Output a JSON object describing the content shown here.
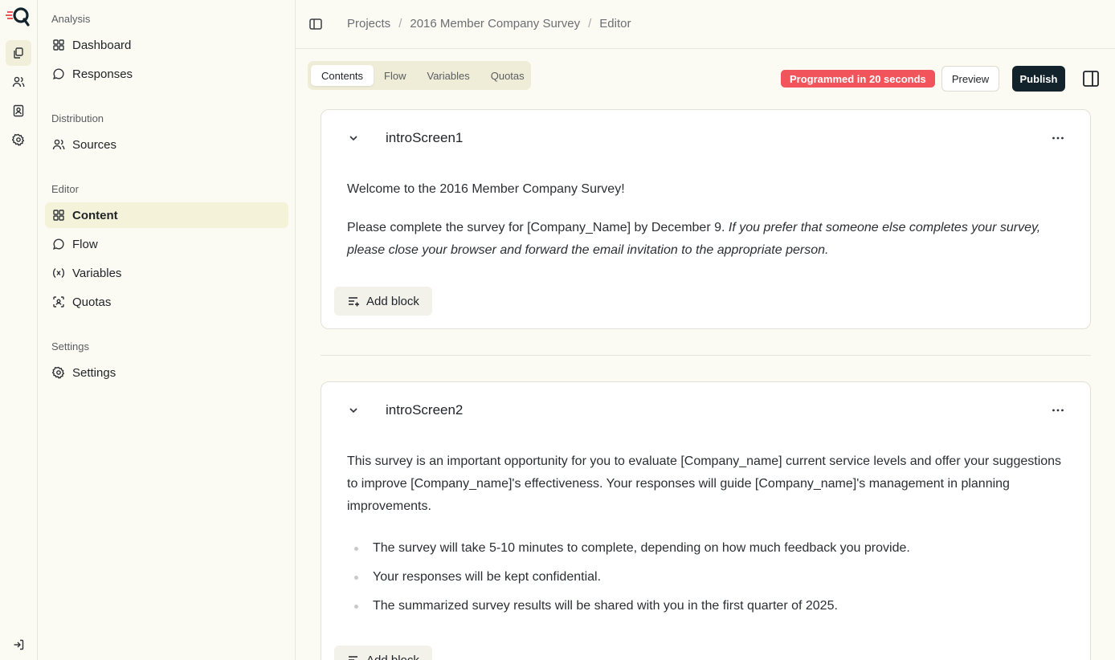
{
  "rail": {
    "icons": [
      "logo-icon",
      "projects-icon",
      "users-icon",
      "contacts-icon",
      "settings-icon",
      "logout-icon"
    ]
  },
  "sidebar": {
    "groups": [
      {
        "label": "Analysis",
        "items": [
          {
            "label": "Dashboard",
            "icon": "grid-icon"
          },
          {
            "label": "Responses",
            "icon": "chat-icon"
          }
        ]
      },
      {
        "label": "Distribution",
        "items": [
          {
            "label": "Sources",
            "icon": "users-icon"
          }
        ]
      },
      {
        "label": "Editor",
        "items": [
          {
            "label": "Content",
            "icon": "grid-icon",
            "active": true
          },
          {
            "label": "Flow",
            "icon": "chat-icon"
          },
          {
            "label": "Variables",
            "icon": "variable-icon"
          },
          {
            "label": "Quotas",
            "icon": "quota-icon"
          }
        ]
      },
      {
        "label": "Settings",
        "items": [
          {
            "label": "Settings",
            "icon": "gear-icon"
          }
        ]
      }
    ]
  },
  "breadcrumb": [
    "Projects",
    "2016 Member Company Survey",
    "Editor"
  ],
  "tabs": [
    "Contents",
    "Flow",
    "Variables",
    "Quotas"
  ],
  "active_tab": "Contents",
  "status_badge": "Programmed in 20 seconds",
  "buttons": {
    "preview": "Preview",
    "publish": "Publish",
    "add_block": "Add block"
  },
  "colors": {
    "accent": "#f2545b",
    "primary": "#13232c",
    "active_bg": "#f4f2d9"
  },
  "cards": [
    {
      "title": "introScreen1",
      "p1": "Welcome to the 2016 Member Company Survey!",
      "p2_plain": "Please complete the survey for [Company_Name] by December 9. ",
      "p2_italic": "If you prefer that someone else completes your survey, please close your browser and forward the email invitation to the appropriate person."
    },
    {
      "title": "introScreen2",
      "p1": "This survey is an important opportunity for you to evaluate [Company_name] current service levels and offer your suggestions to improve [Company_name]'s effectiveness. Your responses will guide [Company_name]'s management in planning improvements.",
      "bullets": [
        "The survey will take 5-10 minutes to complete, depending on how much feedback you provide.",
        "Your responses will be kept confidential.",
        "The summarized survey results will be shared with you in the first quarter of 2025."
      ]
    }
  ]
}
